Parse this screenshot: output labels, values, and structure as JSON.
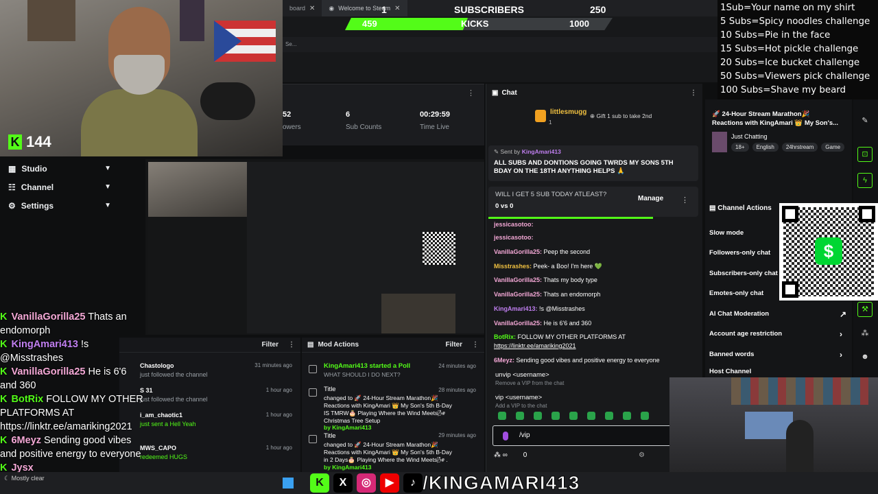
{
  "webcam": {
    "kick_count": "144"
  },
  "browser": {
    "tabs": [
      {
        "label": "board"
      },
      {
        "label": "Welcome to Steam"
      }
    ],
    "address_hint": "Se..."
  },
  "sub_goal": {
    "label": "SUBSCRIBERS",
    "current": "1",
    "goal": "250",
    "progress": 0.004
  },
  "kicks_goal": {
    "label": "KICKS",
    "current": "459",
    "goal": "1000",
    "progress": 0.459
  },
  "goals_overlay": [
    "1Sub=Your name on my shirt",
    "5 Subs=Spicy noodles challenge",
    "10 Subs=Pie in the face",
    "15 Subs=Hot pickle challenge",
    "20 Subs=Ice bucket challenge",
    "50 Subs=Viewers pick challenge",
    "100 Subs=Shave my beard"
  ],
  "stats": [
    {
      "value": "52",
      "label": "owers"
    },
    {
      "value": "6",
      "label": "Sub Counts"
    },
    {
      "value": "00:29:59",
      "label": "Time Live"
    }
  ],
  "sidebar": {
    "items": [
      {
        "label": "Studio"
      },
      {
        "label": "Channel"
      },
      {
        "label": "Settings"
      }
    ]
  },
  "overlay_chat": [
    {
      "user": "VanillaGorilla25",
      "text": "Thats an endomorph",
      "color": "#f4a8d6"
    },
    {
      "user": "KingAmari413",
      "text": "!s @Misstrashes",
      "color": "#c07ff0"
    },
    {
      "user": "VanillaGorilla25",
      "text": "He is 6'6 and 360",
      "color": "#f4a8d6"
    },
    {
      "user": "BotRix",
      "text": "FOLLOW MY OTHER PLATFORMS AT https://linktr.ee/amariking2021",
      "color": "#53fc18"
    },
    {
      "user": "6Meyz",
      "text": "Sending good vibes and positive energy to everyone",
      "color": "#f4a8d6"
    },
    {
      "user": "Jysx",
      "text": "",
      "color": "#f4a8d6"
    }
  ],
  "activity_feed": {
    "filter_label": "Filter",
    "items": [
      {
        "name": "Chastologo",
        "text": "just followed the channel",
        "time": "31 minutes ago"
      },
      {
        "name": "S 31",
        "text": "just followed the channel",
        "time": "1 hour ago"
      },
      {
        "name": "i_am_chaotic1",
        "text": "just sent a Hell Yeah",
        "time": "1 hour ago"
      },
      {
        "name": "MWS_CAPO",
        "text": "redeemed HUGS",
        "time": "1 hour ago"
      }
    ]
  },
  "mod_actions": {
    "title": "Mod Actions",
    "filter_label": "Filter",
    "items": [
      {
        "title": "KingAmari413 started a Poll",
        "sub": "WHAT SHOULD I DO NEXT?",
        "time": "24 minutes ago"
      },
      {
        "title": "Title",
        "sub": "changed to 🚀 24-Hour Stream Marathon🎉 Reactions with KingAmari 👑 My Son's 5th B-Day IS TMRW🎂 Playing Where the Wind Meets🌬 Christmas Tree Setup",
        "by": "by KingAmari413",
        "time": "28 minutes ago"
      },
      {
        "title": "Title",
        "sub": "changed to 🚀 24-Hour Stream Marathon🎉 Reactions with KingAmari 👑 My Son's 5th B-Day in 2 Days🎂 Playing Where the Wind Meets🌬 .",
        "by": "by KingAmari413",
        "time": "29 minutes ago"
      }
    ]
  },
  "chat": {
    "title": "Chat",
    "top_gifter": {
      "name": "littlesmugg",
      "count": "1"
    },
    "gift_cta": "Gift 1 sub to take 2nd",
    "pinned": {
      "sent_by": "Sent by",
      "author": "KingAmari413",
      "text": "ALL SUBS AND DONTIONS GOING TWRDS MY SONS 5TH BDAY ON THE 18TH ANYTHING HELPS 🙏"
    },
    "poll": {
      "question": "WILL I GET 5 SUB TODAY ATLEAST?",
      "score": "0 vs 0",
      "manage_label": "Manage"
    },
    "messages": [
      {
        "user": "jessicasotoo:",
        "text": "",
        "color": "#f4a8d6"
      },
      {
        "user": "jessicasotoo:",
        "text": "",
        "color": "#f4a8d6"
      },
      {
        "user": "VanillaGorilla25:",
        "text": "Peep the second",
        "color": "#f4a8d6"
      },
      {
        "user": "Misstrashes:",
        "text": "Peek- a Boo! I'm here 💚",
        "color": "#f0c040"
      },
      {
        "user": "VanillaGorilla25:",
        "text": "Thats my body type",
        "color": "#f4a8d6"
      },
      {
        "user": "VanillaGorilla25:",
        "text": "Thats an endomorph",
        "color": "#f4a8d6"
      },
      {
        "user": "KingAmari413:",
        "text": "!s @Misstrashes",
        "color": "#c07ff0"
      },
      {
        "user": "VanillaGorilla25:",
        "text": "He is 6'6 and 360",
        "color": "#f4a8d6"
      },
      {
        "user": "BotRix:",
        "text": "FOLLOW MY OTHER PLATFORMS AT",
        "color": "#53fc18"
      },
      {
        "user": "",
        "text": "https://linktr.ee/amariking2021",
        "color": "#fff"
      },
      {
        "user": "6Meyz:",
        "text": "Sending good vibes and positive energy to everyone",
        "color": "#f4a8d6"
      }
    ],
    "commands": [
      {
        "cmd": "unvip <username>",
        "hint": "Remove a VIP from the chat"
      },
      {
        "cmd": "vip <username>",
        "hint": "Add a VIP to the chat"
      }
    ],
    "input_value": "/vip",
    "footer_points": "0"
  },
  "stream_info": {
    "title": "🚀 24-Hour Stream Marathon🎉 Reactions with KingAmari 👑 My Son's...",
    "category": "Just Chatting",
    "tags": [
      "18+",
      "English",
      "24hrstream",
      "Game"
    ]
  },
  "channel_actions": {
    "title": "Channel Actions",
    "items": [
      {
        "label": "Slow mode"
      },
      {
        "label": "Followers-only chat"
      },
      {
        "label": "Subscribers-only chat"
      },
      {
        "label": "Emotes-only chat"
      },
      {
        "label": "AI Chat Moderation"
      },
      {
        "label": "Account age restriction"
      },
      {
        "label": "Banned words"
      },
      {
        "label": "Host Channel"
      }
    ]
  },
  "taskbar": {
    "weather": "Mostly clear",
    "handle": "/KINGAMARI413"
  }
}
